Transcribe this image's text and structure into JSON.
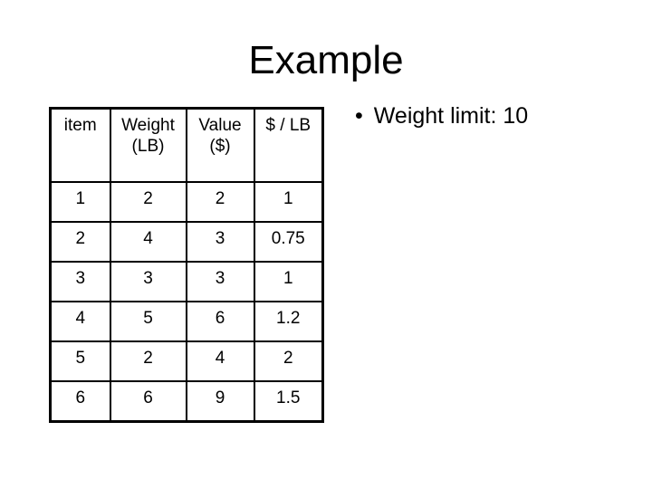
{
  "title": "Example",
  "table": {
    "headers": [
      [
        "item"
      ],
      [
        "Weight",
        "(LB)"
      ],
      [
        "Value",
        "($)"
      ],
      [
        "$ / LB"
      ]
    ],
    "rows": [
      [
        "1",
        "2",
        "2",
        "1"
      ],
      [
        "2",
        "4",
        "3",
        "0.75"
      ],
      [
        "3",
        "3",
        "3",
        "1"
      ],
      [
        "4",
        "5",
        "6",
        "1.2"
      ],
      [
        "5",
        "2",
        "4",
        "2"
      ],
      [
        "6",
        "6",
        "9",
        "1.5"
      ]
    ]
  },
  "bullets": [
    {
      "icon": "bullet-dot",
      "glyph": "•",
      "text": "Weight limit: 10"
    }
  ]
}
